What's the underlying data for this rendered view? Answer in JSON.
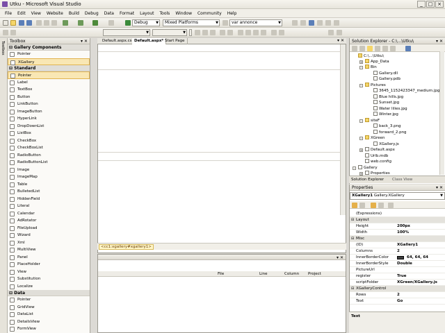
{
  "window": {
    "title": "Utku - Microsoft Visual Studio"
  },
  "menu": [
    "File",
    "Edit",
    "View",
    "Website",
    "Build",
    "Debug",
    "Data",
    "Format",
    "Layout",
    "Tools",
    "Window",
    "Community",
    "Help"
  ],
  "toolbar": {
    "config": "Debug",
    "platform": "Mixed Platforms",
    "find": "var annonce"
  },
  "toolbox": {
    "title": "Toolbox",
    "groups": [
      {
        "name": "Gallery Components",
        "items": [
          "Pointer",
          "XGallery"
        ]
      },
      {
        "name": "Standard",
        "items": [
          "Pointer",
          "Label",
          "TextBox",
          "Button",
          "LinkButton",
          "ImageButton",
          "HyperLink",
          "DropDownList",
          "ListBox",
          "CheckBox",
          "CheckBoxList",
          "RadioButton",
          "RadioButtonList",
          "Image",
          "ImageMap",
          "Table",
          "BulletedList",
          "HiddenField",
          "Literal",
          "Calendar",
          "AdRotator",
          "FileUpload",
          "Wizard",
          "Xml",
          "MultiView",
          "Panel",
          "PlaceHolder",
          "View",
          "Substitution",
          "Localize"
        ]
      },
      {
        "name": "Data",
        "items": [
          "Pointer",
          "GridView",
          "DataList",
          "DetailsView",
          "FormView"
        ]
      }
    ]
  },
  "editor": {
    "tabs": [
      "Default.aspx.cs",
      "Default.aspx*",
      "Start Page"
    ],
    "tag_breadcrumb": "<cc1:xgallery#xgallery1>"
  },
  "errorlist": {
    "columns": [
      "File",
      "Line",
      "Column",
      "Project"
    ]
  },
  "solution": {
    "title": "Solution Explorer - C:\\...\\Utku\\",
    "root": "C:\\...\\Utku\\",
    "items": [
      "App_Data",
      "Bin",
      "Gallery.dll",
      "Gallery.pdb",
      "Pictures",
      "3645_1152423347_medium.jpg",
      "Blue hills.jpg",
      "Sunset.jpg",
      "Water lilies.jpg",
      "Winter.jpg",
      "siteF",
      "back_3.png",
      "forward_2.png",
      "XGreen",
      "XGallery.js",
      "Default.aspx",
      "Urlb.mdb",
      "web.config",
      "Gallery",
      "Properties"
    ],
    "tabs": [
      "Solution Explorer",
      "Class View"
    ]
  },
  "properties": {
    "title": "Properties",
    "object": "XGallery1",
    "object_type": "Gallery.XGallery",
    "rows": [
      {
        "name": "(Expressions)",
        "value": "",
        "cat": false
      },
      {
        "name": "Layout",
        "value": "",
        "cat": true
      },
      {
        "name": "Height",
        "value": "200px",
        "cat": false
      },
      {
        "name": "Width",
        "value": "100%",
        "cat": false
      },
      {
        "name": "Misc",
        "value": "",
        "cat": true
      },
      {
        "name": "(ID)",
        "value": "XGallery1",
        "cat": false
      },
      {
        "name": "Columns",
        "value": "2",
        "cat": false
      },
      {
        "name": "InnerBorderColor",
        "value": "64, 64, 64",
        "cat": false
      },
      {
        "name": "InnerBorderStyle",
        "value": "Double",
        "cat": false
      },
      {
        "name": "PictureUrl",
        "value": "",
        "cat": false
      },
      {
        "name": "register",
        "value": "True",
        "cat": false
      },
      {
        "name": "scriptFolder",
        "value": "XGreen/XGallery.js",
        "cat": false
      },
      {
        "name": "XGalleryControl",
        "value": "",
        "cat": true
      },
      {
        "name": "Rows",
        "value": "2",
        "cat": false
      },
      {
        "name": "Text",
        "value": "Go",
        "cat": false
      }
    ],
    "description": "Text"
  },
  "colors": {
    "selection": "#f9e7b4",
    "selection_border": "#e1b34f",
    "folder": "#f5d66a",
    "swatch": "#404040"
  }
}
